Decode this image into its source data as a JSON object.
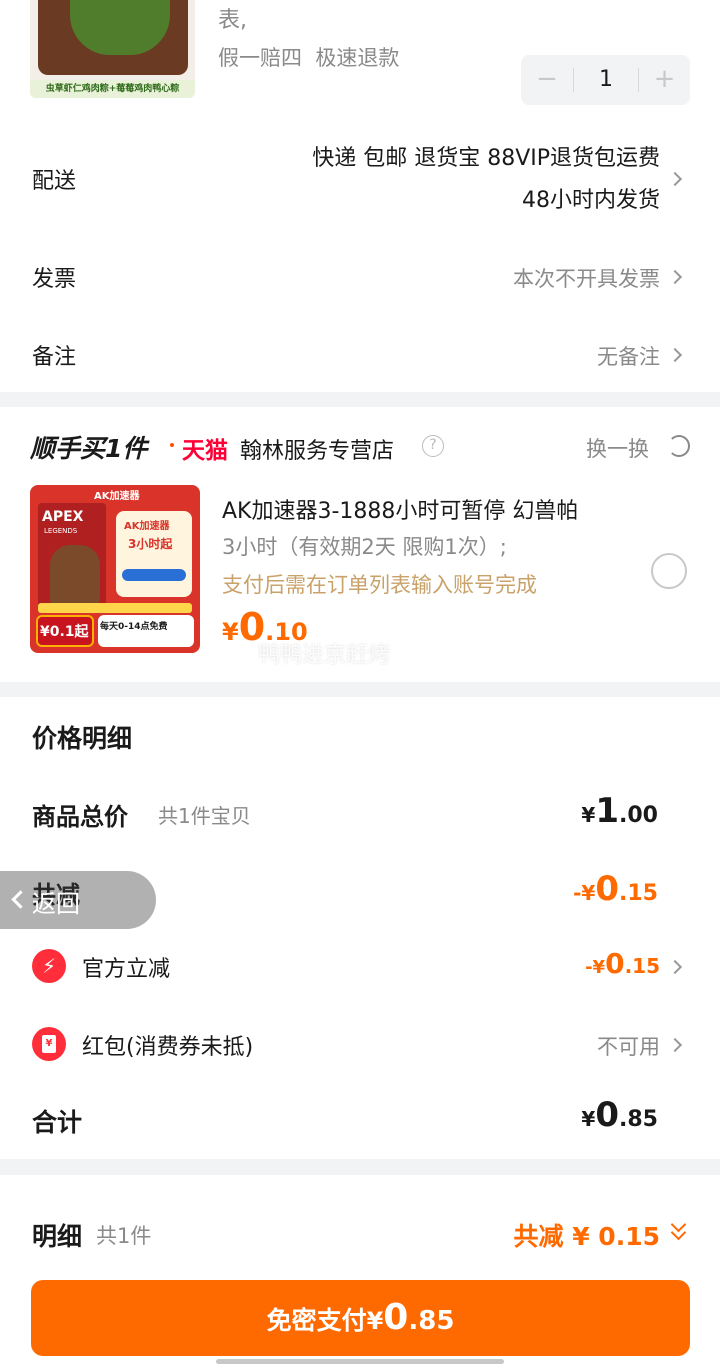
{
  "product": {
    "tags_line": "表,",
    "service": "假一赔四  极速退款",
    "qty": "1",
    "thumb_caption": "虫草虾仁鸡肉粽+莓莓鸡肉鸭心粽"
  },
  "rows": {
    "delivery_label": "配送",
    "delivery_line1": "快递 包邮 退货宝 88VIP退货包运费",
    "delivery_line2": "48小时内发货",
    "invoice_label": "发票",
    "invoice_value": "本次不开具发票",
    "remark_label": "备注",
    "remark_value": "无备注"
  },
  "shunshou": {
    "brand": "顺手买1件",
    "tmall": "天猫",
    "store": "翰林服务专营店",
    "refresh": "换一换",
    "title": "AK加速器3-1888小时可暂停 幻兽帕",
    "sub1": "3小时（有效期2天 限购1次）;",
    "sub2": "支付后需在订单列表输入账号完成",
    "price_symbol": "¥",
    "price_int": "0",
    "price_dec": ".10",
    "overlay_text": "鸭鸭进京赶烤",
    "thumb": {
      "logo": "AK加速器",
      "apex": "APEX",
      "legends": "LEGENDS",
      "name": "AK加速器",
      "hours": "3小时起",
      "price": "¥0.1起",
      "daily": "每天0-14点免费"
    }
  },
  "price_detail": {
    "title": "价格明细",
    "total_label": "商品总价",
    "total_count": "共1件宝贝",
    "total_sym": "¥",
    "total_int": "1",
    "total_dec": ".00",
    "reduce_label": "共减",
    "reduce_sym": "-¥",
    "reduce_int": "0",
    "reduce_dec": ".15",
    "official_label": "官方立减",
    "official_sym": "-¥",
    "official_int": "0",
    "official_dec": ".15",
    "redpacket_label": "红包(消费券未抵)",
    "redpacket_value": "不可用",
    "sum_label": "合计",
    "sum_sym": "¥",
    "sum_int": "0",
    "sum_dec": ".85"
  },
  "back_button": "返回",
  "footer": {
    "label": "明细",
    "count": "共1件",
    "reduce": "共减 ¥ 0.15",
    "pay_prefix": "免密支付",
    "pay_sym": "¥",
    "pay_int": "0",
    "pay_dec": ".85"
  },
  "colors": {
    "accent": "#ff5000",
    "price_orange": "#ff6a00",
    "tmall_red": "#ff0036"
  }
}
